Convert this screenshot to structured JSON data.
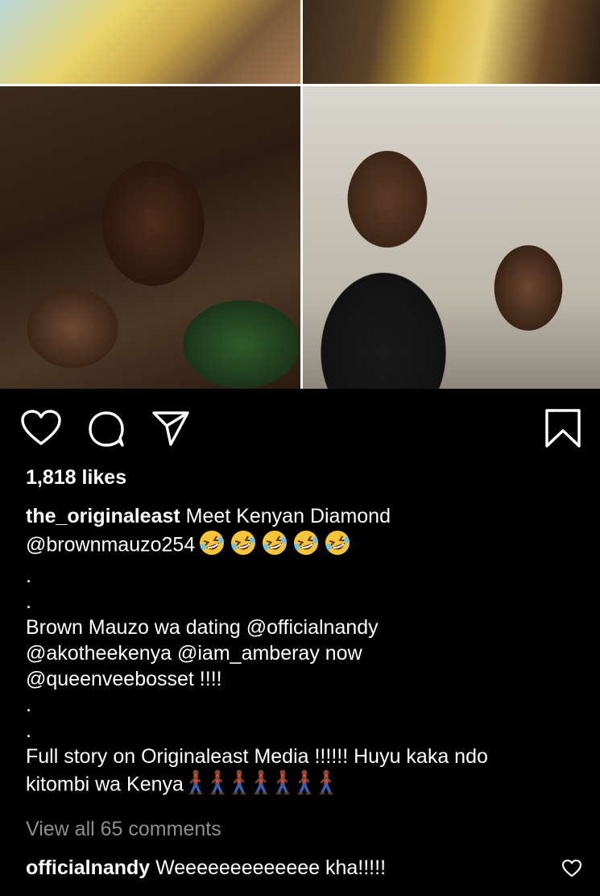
{
  "post": {
    "likes": "1,818 likes",
    "caption": {
      "username": "the_originaleast",
      "line1_text": " Meet Kenyan Diamond",
      "line2_text": "@brownmauzo254",
      "line2_emoji": "rolling-on-floor-laughing-emoji",
      "line2_emoji_count": 5,
      "dot1": ".",
      "dot2": ".",
      "line3": "Brown Mauzo wa dating @officialnandy",
      "line4": "@akotheekenya  @iam_amberay now",
      "line5": "@queenveebosset !!!!",
      "dot3": ".",
      "dot4": ".",
      "line6": "Full story on Originaleast Media !!!!!! Huyu kaka ndo",
      "line7_text": "kitombi wa Kenya",
      "line7_emoji": "person-walking-emoji",
      "line7_emoji_count": 7
    },
    "view_comments": "View all 65 comments",
    "comment": {
      "username": "officialnandy",
      "text": " Weeeeeeeeeeeee kha!!!!!"
    }
  },
  "colors": {
    "background": "#000000",
    "text": "#ffffff",
    "muted": "#8e8e8e"
  },
  "icons": [
    "heart-icon",
    "comment-icon",
    "share-icon",
    "bookmark-icon",
    "comment-like-heart-icon"
  ]
}
